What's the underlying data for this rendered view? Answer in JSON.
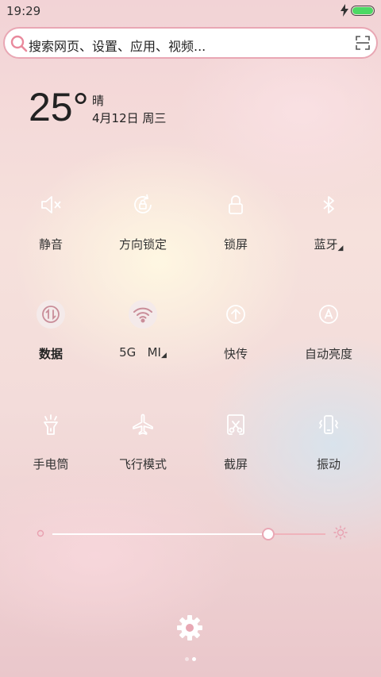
{
  "status_bar": {
    "time": "19:29",
    "battery_percent": 100,
    "battery_color": "#4cd964"
  },
  "search": {
    "placeholder": "搜索网页、设置、应用、视频..."
  },
  "weather": {
    "temperature": "25°",
    "condition": "晴",
    "date": "4月12日 周三"
  },
  "toggles": [
    {
      "label": "静音",
      "icon": "mute-icon"
    },
    {
      "label": "方向锁定",
      "icon": "rotation-lock-icon"
    },
    {
      "label": "锁屏",
      "icon": "lock-icon"
    },
    {
      "label": "蓝牙",
      "icon": "bluetooth-icon",
      "has_more": true
    },
    {
      "label": "数据",
      "icon": "mobile-data-icon",
      "active": true
    },
    {
      "label": "5G   MI",
      "icon": "wifi-icon",
      "active": true,
      "has_more": true
    },
    {
      "label": "快传",
      "icon": "transfer-icon"
    },
    {
      "label": "自动亮度",
      "icon": "auto-brightness-icon"
    },
    {
      "label": "手电筒",
      "icon": "flashlight-icon"
    },
    {
      "label": "飞行模式",
      "icon": "airplane-icon"
    },
    {
      "label": "截屏",
      "icon": "screenshot-icon"
    },
    {
      "label": "振动",
      "icon": "vibrate-icon"
    }
  ],
  "brightness": {
    "level": 0.79
  },
  "colors": {
    "accent": "#e9a7b4",
    "icon_pink": "#e8a0b0",
    "active_pink": "#c98d99"
  },
  "pager": {
    "pages": 2,
    "current": 2
  }
}
